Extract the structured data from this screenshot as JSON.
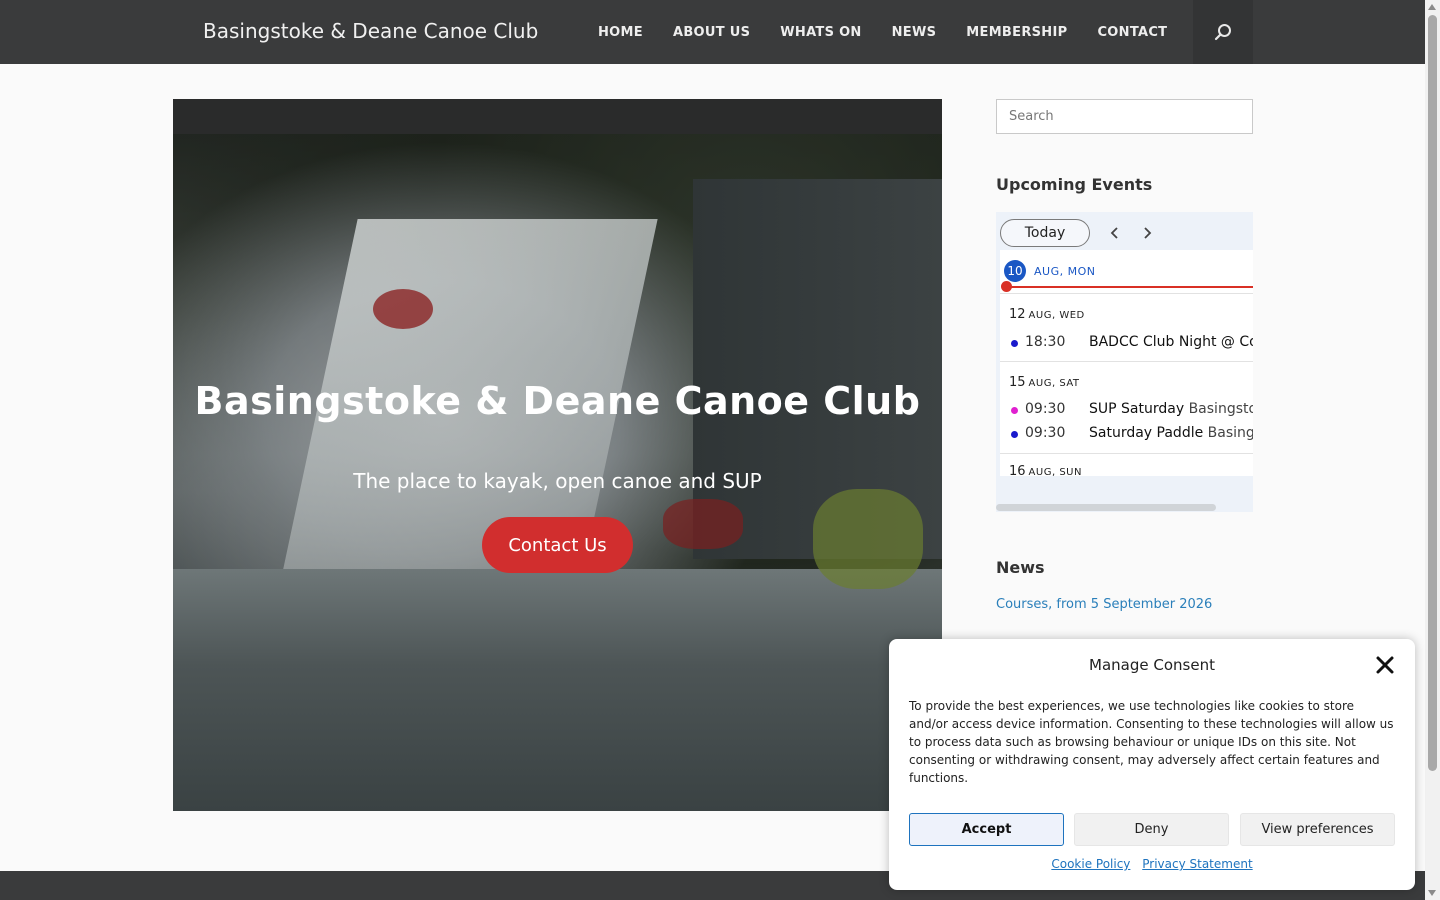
{
  "header": {
    "site_title": "Basingstoke & Deane Canoe Club",
    "nav": [
      "HOME",
      "ABOUT US",
      "WHATS ON",
      "NEWS",
      "MEMBERSHIP",
      "CONTACT"
    ],
    "search_icon": "search-icon"
  },
  "hero": {
    "title": "Basingstoke & Deane Canoe Club",
    "subtitle": "The place to kayak, open canoe and SUP",
    "button_label": "Contact Us",
    "button_color": "#d12e2e"
  },
  "sidebar": {
    "search_placeholder": "Search",
    "events_title": "Upcoming Events",
    "calendar": {
      "today_label": "Today",
      "today_day": "10",
      "today_date": "AUG, MON",
      "days": [
        {
          "day": "12",
          "date": "AUG, WED",
          "events": [
            {
              "time": "18:30",
              "title": "BADCC Club Night @ Col",
              "location": "",
              "color": "#1a1acc"
            }
          ]
        },
        {
          "day": "15",
          "date": "AUG, SAT",
          "events": [
            {
              "time": "09:30",
              "title": "SUP Saturday",
              "location": "Basingstoke",
              "color": "#e020d0"
            },
            {
              "time": "09:30",
              "title": "Saturday Paddle",
              "location": "Basingstoke",
              "color": "#1a1acc"
            }
          ]
        },
        {
          "day": "16",
          "date": "AUG, SUN",
          "events": []
        }
      ]
    },
    "news_title": "News",
    "news_link": "Courses, from 5 September 2026"
  },
  "consent": {
    "title": "Manage Consent",
    "text": "To provide the best experiences, we use technologies like cookies to store and/or access device information. Consenting to these technologies will allow us to process data such as browsing behaviour or unique IDs on this site. Not consenting or withdrawing consent, may adversely affect certain features and functions.",
    "accept": "Accept",
    "deny": "Deny",
    "preferences": "View preferences",
    "cookie_policy": "Cookie Policy",
    "privacy_statement": "Privacy Statement"
  }
}
